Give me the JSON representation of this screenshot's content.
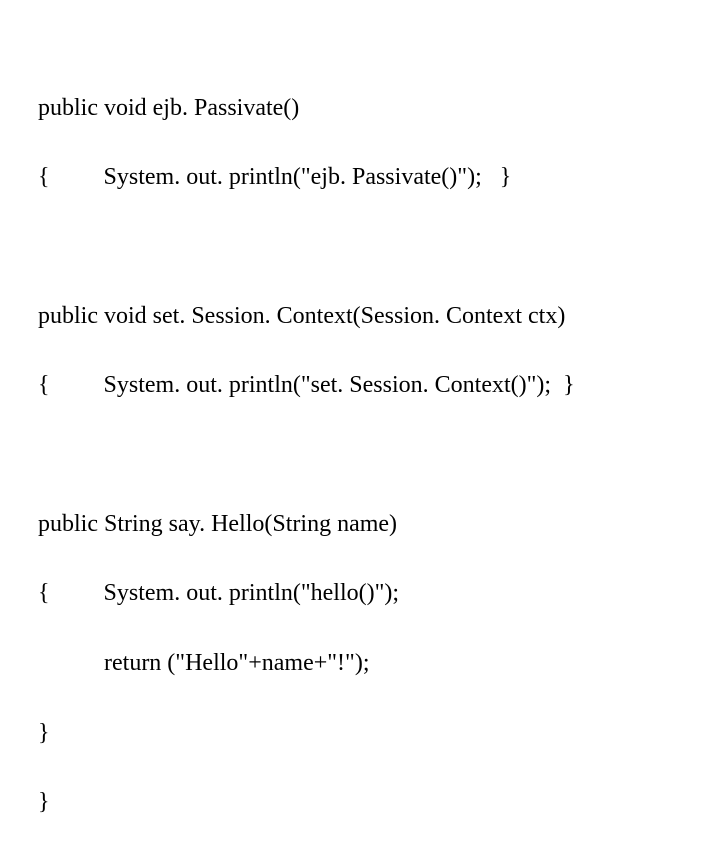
{
  "code": {
    "l1": "public void ejb. Passivate()",
    "l2": "{         System. out. println(\"ejb. Passivate()\");   }",
    "l3": "public void set. Session. Context(Session. Context ctx)",
    "l4": "{         System. out. println(\"set. Session. Context()\");  }",
    "l5": "public String say. Hello(String name)",
    "l6": "{         System. out. println(\"hello()\");",
    "l7": "           return (\"Hello\"+name+\"!\");",
    "l8": "}",
    "l9": "}"
  }
}
